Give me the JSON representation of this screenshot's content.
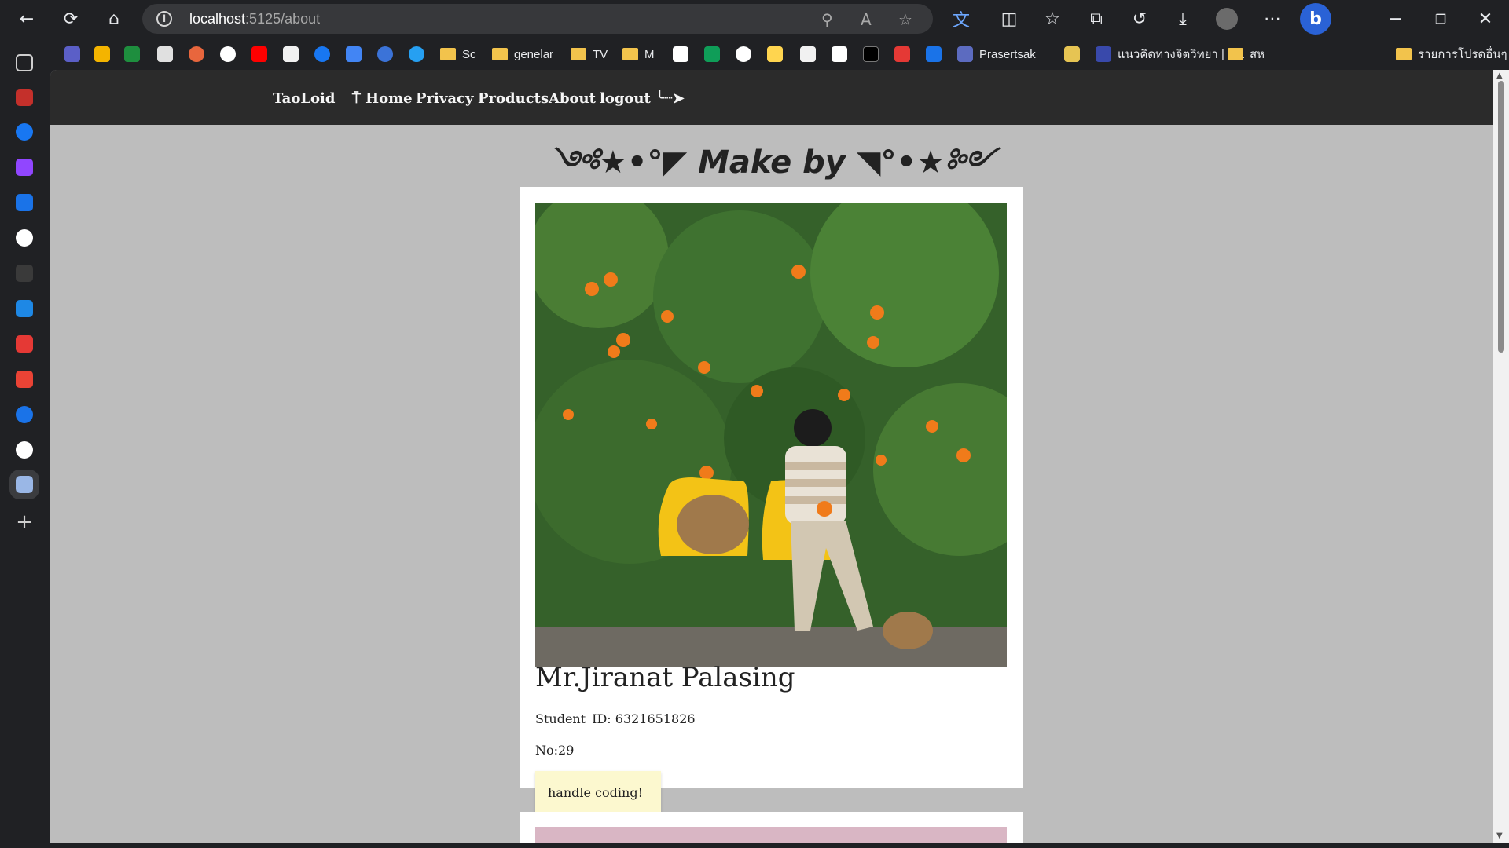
{
  "browser": {
    "url_host": "localhost",
    "url_port_path": ":5125/about",
    "bookmarks": [
      "Sc",
      "genelar",
      "TV",
      "M",
      "Prasertsak",
      "แนวคิดทางจิตวิทยา | แ...",
      "สห",
      "รายการโปรดอื่นๆ"
    ],
    "icons": [
      "back-icon",
      "refresh-icon",
      "home-icon",
      "info-icon",
      "zoom-icon",
      "read-aloud-icon",
      "favorite-star-icon",
      "translate-icon",
      "split-screen-icon",
      "favorites-icon",
      "collections-icon",
      "history-icon",
      "download-icon",
      "profile-avatar",
      "more-icon",
      "copilot-icon",
      "minimize-icon",
      "restore-icon",
      "close-icon"
    ]
  },
  "navbar": {
    "brand": "TaoLoid",
    "home": "⍑ Home",
    "privacy": "Privacy",
    "products": "Products",
    "about": "About",
    "logout": "logout ╰┈➤"
  },
  "page": {
    "heading": "༺★•°◤ Make by ◥°•★༻",
    "profile": {
      "name": "Mr.Jiranat Palasing",
      "student_id": "Student_ID: 6321651826",
      "number": "No:29"
    },
    "note": "handle coding!"
  },
  "colors": {
    "navbar": "#2b2b2b",
    "background": "#bdbdbd",
    "note": "#fcf8cf"
  }
}
